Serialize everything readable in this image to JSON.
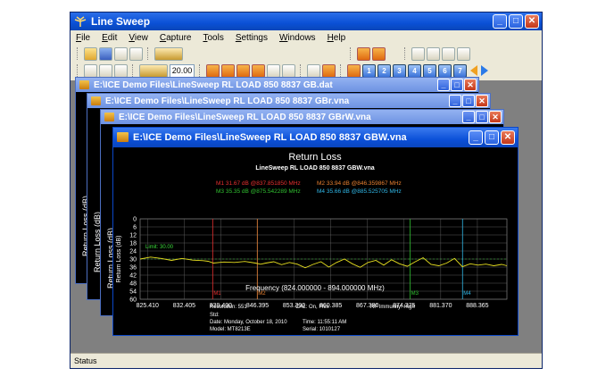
{
  "app": {
    "title": "Line Sweep",
    "menu": [
      "File",
      "Edit",
      "View",
      "Capture",
      "Tools",
      "Settings",
      "Windows",
      "Help"
    ],
    "toolbar": {
      "value_field": "20.00",
      "page_buttons": [
        "1",
        "2",
        "3",
        "4",
        "5",
        "6",
        "7"
      ]
    },
    "status": "Status"
  },
  "windows": [
    {
      "title": "E:\\ICE Demo Files\\LineSweep RL LOAD 850 8837 GB.dat"
    },
    {
      "title": "E:\\ICE Demo Files\\LineSweep RL LOAD 850 8837 GBr.vna"
    },
    {
      "title": "E:\\ICE Demo Files\\LineSweep RL LOAD 850 8837 GBrW.vna"
    },
    {
      "title": "E:\\ICE Demo Files\\LineSweep RL LOAD 850 8837 GBW.vna"
    }
  ],
  "back_ylabel": "Return Loss (dB)",
  "chart_data": {
    "type": "line",
    "title": "Return Loss",
    "subtitle": "LineSweep RL LOAD 850 8837 GBW.vna",
    "xlabel": "Frequency (824.000000 - 894.000000 MHz)",
    "ylabel": "Return Loss (dB)",
    "xlim": [
      824.0,
      894.0
    ],
    "ylim": [
      0,
      60
    ],
    "y_inverted": true,
    "xticks": [
      "825.410",
      "832.405",
      "839.400",
      "846.395",
      "853.390",
      "860.385",
      "867.380",
      "874.375",
      "881.370",
      "888.365"
    ],
    "yticks": [
      0,
      6,
      12,
      18,
      24,
      30,
      36,
      42,
      48,
      54,
      60
    ],
    "grid": true,
    "limit": {
      "label": "Limit: 30.00",
      "value": 30
    },
    "series": [
      {
        "color": "#e8e020",
        "x": [
          824.0,
          826.0,
          828.0,
          830.0,
          832.0,
          834.0,
          836.0,
          837.0,
          838.0,
          840.0,
          842.0,
          844.0,
          846.0,
          847.0,
          848.0,
          849.5,
          851.0,
          852.5,
          854.0,
          855.5,
          857.0,
          858.5,
          860.0,
          861.5,
          863.0,
          864.5,
          866.0,
          867.5,
          869.0,
          870.5,
          872.0,
          873.5,
          875.0,
          876.5,
          878.0,
          879.5,
          881.0,
          882.5,
          884.0,
          885.5,
          887.0,
          888.5,
          890.0,
          891.5,
          893.0,
          894.0
        ],
        "y": [
          30.0,
          28.5,
          29.5,
          31.0,
          29.5,
          30.8,
          31.2,
          31.7,
          33.0,
          32.2,
          32.5,
          31.8,
          33.0,
          33.9,
          33.0,
          32.0,
          34.2,
          32.5,
          33.8,
          36.5,
          34.0,
          32.0,
          36.0,
          32.5,
          30.0,
          33.5,
          36.2,
          32.5,
          31.0,
          34.5,
          30.5,
          33.5,
          35.4,
          32.0,
          29.0,
          34.0,
          35.0,
          33.0,
          29.5,
          35.7,
          33.5,
          34.5,
          33.8,
          35.0,
          34.0,
          35.0
        ]
      }
    ],
    "markers": [
      {
        "id": "M1",
        "label": "M1 31.67 dB @837.851850 MHz",
        "x": 837.85,
        "color": "#e83030"
      },
      {
        "id": "M2",
        "label": "M2 33.94 dB @846.359867 MHz",
        "x": 846.36,
        "color": "#e88030"
      },
      {
        "id": "M3",
        "label": "M3 35.35 dB @875.542289 MHz",
        "x": 875.54,
        "color": "#30c030"
      },
      {
        "id": "M4",
        "label": "M4 35.66 dB @885.525705 MHz",
        "x": 885.53,
        "color": "#30b8e8"
      }
    ],
    "info": {
      "resolution": "Resolution: 551",
      "cal": "CAL: On, Flex",
      "rf": "RF Immunity: High",
      "std": "Std:",
      "date": "Date: Monday, October 18, 2010",
      "time": "Time: 11:55:11 AM",
      "model": "Model: MT8213E",
      "serial": "Serial: 1010127"
    }
  }
}
